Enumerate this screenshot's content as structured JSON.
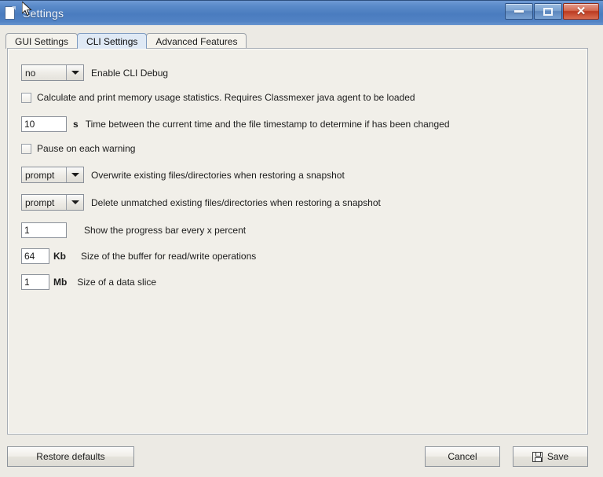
{
  "window": {
    "title": "Settings",
    "icon": "document-icon",
    "controls": {
      "minimize_label": "Minimize",
      "maximize_label": "Maximize",
      "close_label": "✕"
    }
  },
  "tabs": [
    {
      "label": "GUI Settings",
      "selected": false
    },
    {
      "label": "CLI Settings",
      "selected": true
    },
    {
      "label": "Advanced Features",
      "selected": false
    }
  ],
  "settings": {
    "enable_cli_debug": {
      "control": "combo",
      "value": "no",
      "label": "Enable CLI Debug"
    },
    "memory_stats": {
      "control": "checkbox",
      "checked": false,
      "label": "Calculate and print memory usage statistics. Requires Classmexer java agent to be loaded"
    },
    "timestamp_delta": {
      "control": "text",
      "value": "10",
      "unit": "s",
      "label": "Time between the current time and the file timestamp to determine if has been changed"
    },
    "pause_on_warning": {
      "control": "checkbox",
      "checked": false,
      "label": "Pause on each warning"
    },
    "overwrite_existing": {
      "control": "combo",
      "value": "prompt",
      "label": "Overwrite existing files/directories when restoring a snapshot"
    },
    "delete_unmatched": {
      "control": "combo",
      "value": "prompt",
      "label": "Delete unmatched existing files/directories when restoring a snapshot"
    },
    "progress_percent": {
      "control": "text",
      "value": "1",
      "unit": "",
      "label": "Show the progress bar every x percent"
    },
    "buffer_size": {
      "control": "text",
      "value": "64",
      "unit": "Kb",
      "label": "Size of the buffer for read/write operations"
    },
    "slice_size": {
      "control": "text",
      "value": "1",
      "unit": "Mb",
      "label": "Size of a data slice"
    }
  },
  "buttons": {
    "restore_defaults": "Restore defaults",
    "cancel": "Cancel",
    "save": "Save"
  },
  "colors": {
    "titlebar_blue": "#4a7cbf",
    "close_red": "#bb3a20",
    "panel_bg": "#f1efe9",
    "selected_tab": "#dfe9f5"
  }
}
